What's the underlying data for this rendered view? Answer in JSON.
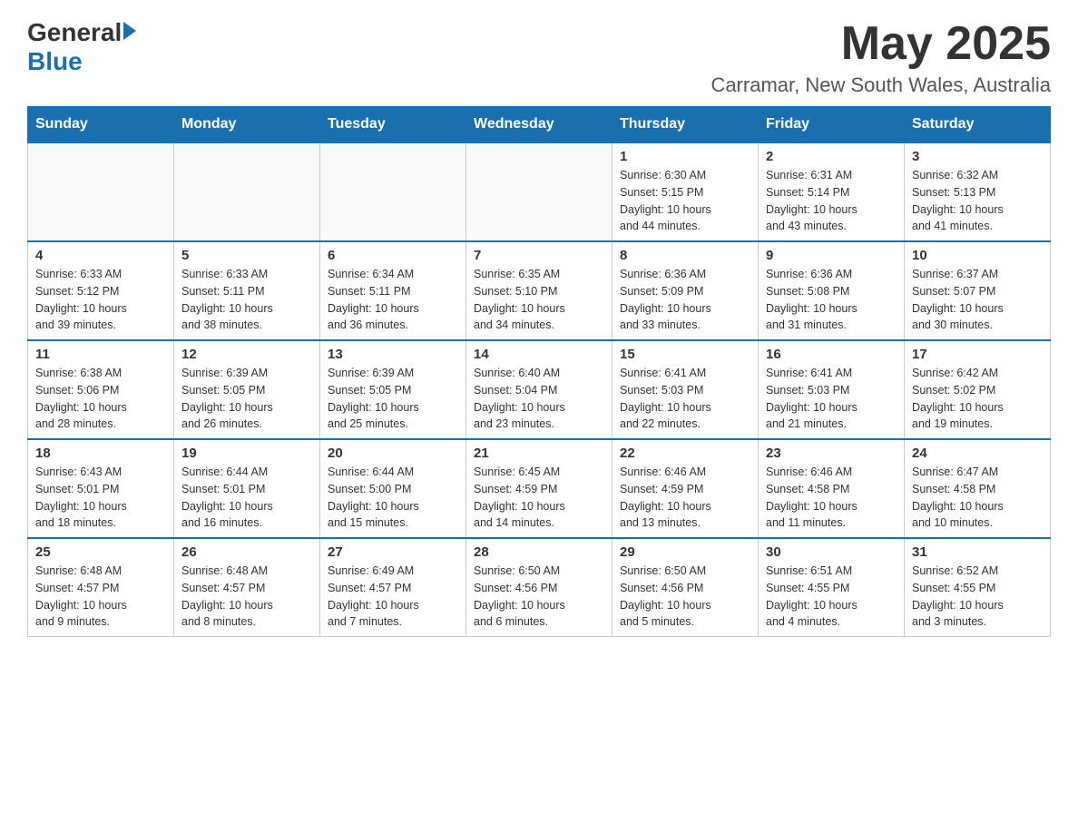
{
  "header": {
    "logo_general": "General",
    "logo_blue": "Blue",
    "month_year": "May 2025",
    "location": "Carramar, New South Wales, Australia"
  },
  "days_of_week": [
    "Sunday",
    "Monday",
    "Tuesday",
    "Wednesday",
    "Thursday",
    "Friday",
    "Saturday"
  ],
  "weeks": [
    [
      {
        "day": "",
        "info": ""
      },
      {
        "day": "",
        "info": ""
      },
      {
        "day": "",
        "info": ""
      },
      {
        "day": "",
        "info": ""
      },
      {
        "day": "1",
        "info": "Sunrise: 6:30 AM\nSunset: 5:15 PM\nDaylight: 10 hours\nand 44 minutes."
      },
      {
        "day": "2",
        "info": "Sunrise: 6:31 AM\nSunset: 5:14 PM\nDaylight: 10 hours\nand 43 minutes."
      },
      {
        "day": "3",
        "info": "Sunrise: 6:32 AM\nSunset: 5:13 PM\nDaylight: 10 hours\nand 41 minutes."
      }
    ],
    [
      {
        "day": "4",
        "info": "Sunrise: 6:33 AM\nSunset: 5:12 PM\nDaylight: 10 hours\nand 39 minutes."
      },
      {
        "day": "5",
        "info": "Sunrise: 6:33 AM\nSunset: 5:11 PM\nDaylight: 10 hours\nand 38 minutes."
      },
      {
        "day": "6",
        "info": "Sunrise: 6:34 AM\nSunset: 5:11 PM\nDaylight: 10 hours\nand 36 minutes."
      },
      {
        "day": "7",
        "info": "Sunrise: 6:35 AM\nSunset: 5:10 PM\nDaylight: 10 hours\nand 34 minutes."
      },
      {
        "day": "8",
        "info": "Sunrise: 6:36 AM\nSunset: 5:09 PM\nDaylight: 10 hours\nand 33 minutes."
      },
      {
        "day": "9",
        "info": "Sunrise: 6:36 AM\nSunset: 5:08 PM\nDaylight: 10 hours\nand 31 minutes."
      },
      {
        "day": "10",
        "info": "Sunrise: 6:37 AM\nSunset: 5:07 PM\nDaylight: 10 hours\nand 30 minutes."
      }
    ],
    [
      {
        "day": "11",
        "info": "Sunrise: 6:38 AM\nSunset: 5:06 PM\nDaylight: 10 hours\nand 28 minutes."
      },
      {
        "day": "12",
        "info": "Sunrise: 6:39 AM\nSunset: 5:05 PM\nDaylight: 10 hours\nand 26 minutes."
      },
      {
        "day": "13",
        "info": "Sunrise: 6:39 AM\nSunset: 5:05 PM\nDaylight: 10 hours\nand 25 minutes."
      },
      {
        "day": "14",
        "info": "Sunrise: 6:40 AM\nSunset: 5:04 PM\nDaylight: 10 hours\nand 23 minutes."
      },
      {
        "day": "15",
        "info": "Sunrise: 6:41 AM\nSunset: 5:03 PM\nDaylight: 10 hours\nand 22 minutes."
      },
      {
        "day": "16",
        "info": "Sunrise: 6:41 AM\nSunset: 5:03 PM\nDaylight: 10 hours\nand 21 minutes."
      },
      {
        "day": "17",
        "info": "Sunrise: 6:42 AM\nSunset: 5:02 PM\nDaylight: 10 hours\nand 19 minutes."
      }
    ],
    [
      {
        "day": "18",
        "info": "Sunrise: 6:43 AM\nSunset: 5:01 PM\nDaylight: 10 hours\nand 18 minutes."
      },
      {
        "day": "19",
        "info": "Sunrise: 6:44 AM\nSunset: 5:01 PM\nDaylight: 10 hours\nand 16 minutes."
      },
      {
        "day": "20",
        "info": "Sunrise: 6:44 AM\nSunset: 5:00 PM\nDaylight: 10 hours\nand 15 minutes."
      },
      {
        "day": "21",
        "info": "Sunrise: 6:45 AM\nSunset: 4:59 PM\nDaylight: 10 hours\nand 14 minutes."
      },
      {
        "day": "22",
        "info": "Sunrise: 6:46 AM\nSunset: 4:59 PM\nDaylight: 10 hours\nand 13 minutes."
      },
      {
        "day": "23",
        "info": "Sunrise: 6:46 AM\nSunset: 4:58 PM\nDaylight: 10 hours\nand 11 minutes."
      },
      {
        "day": "24",
        "info": "Sunrise: 6:47 AM\nSunset: 4:58 PM\nDaylight: 10 hours\nand 10 minutes."
      }
    ],
    [
      {
        "day": "25",
        "info": "Sunrise: 6:48 AM\nSunset: 4:57 PM\nDaylight: 10 hours\nand 9 minutes."
      },
      {
        "day": "26",
        "info": "Sunrise: 6:48 AM\nSunset: 4:57 PM\nDaylight: 10 hours\nand 8 minutes."
      },
      {
        "day": "27",
        "info": "Sunrise: 6:49 AM\nSunset: 4:57 PM\nDaylight: 10 hours\nand 7 minutes."
      },
      {
        "day": "28",
        "info": "Sunrise: 6:50 AM\nSunset: 4:56 PM\nDaylight: 10 hours\nand 6 minutes."
      },
      {
        "day": "29",
        "info": "Sunrise: 6:50 AM\nSunset: 4:56 PM\nDaylight: 10 hours\nand 5 minutes."
      },
      {
        "day": "30",
        "info": "Sunrise: 6:51 AM\nSunset: 4:55 PM\nDaylight: 10 hours\nand 4 minutes."
      },
      {
        "day": "31",
        "info": "Sunrise: 6:52 AM\nSunset: 4:55 PM\nDaylight: 10 hours\nand 3 minutes."
      }
    ]
  ]
}
